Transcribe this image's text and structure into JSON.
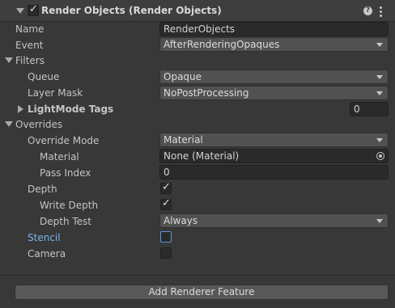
{
  "header": {
    "title": "Render Objects (Render Objects)",
    "enabled": true,
    "help_glyph": "?"
  },
  "fields": {
    "name": {
      "label": "Name",
      "value": "RenderObjects"
    },
    "event": {
      "label": "Event",
      "value": "AfterRenderingOpaques"
    }
  },
  "filters": {
    "label": "Filters",
    "queue": {
      "label": "Queue",
      "value": "Opaque"
    },
    "layer_mask": {
      "label": "Layer Mask",
      "value": "NoPostProcessing"
    },
    "lightmode_tags": {
      "label": "LightMode Tags",
      "value": "0"
    }
  },
  "overrides": {
    "label": "Overrides",
    "override_mode": {
      "label": "Override Mode",
      "value": "Material"
    },
    "material": {
      "label": "Material",
      "value": "None (Material)"
    },
    "pass_index": {
      "label": "Pass Index",
      "value": "0"
    },
    "depth": {
      "label": "Depth",
      "checked": true
    },
    "write_depth": {
      "label": "Write Depth",
      "checked": true
    },
    "depth_test": {
      "label": "Depth Test",
      "value": "Always"
    },
    "stencil": {
      "label": "Stencil",
      "checked": false
    },
    "camera": {
      "label": "Camera",
      "checked": false
    }
  },
  "footer": {
    "add_button_label": "Add Renderer Feature"
  },
  "colors": {
    "background": "#383838",
    "field": "#2a2a2a",
    "dropdown": "#515151",
    "accent": "#7ab3f0"
  }
}
